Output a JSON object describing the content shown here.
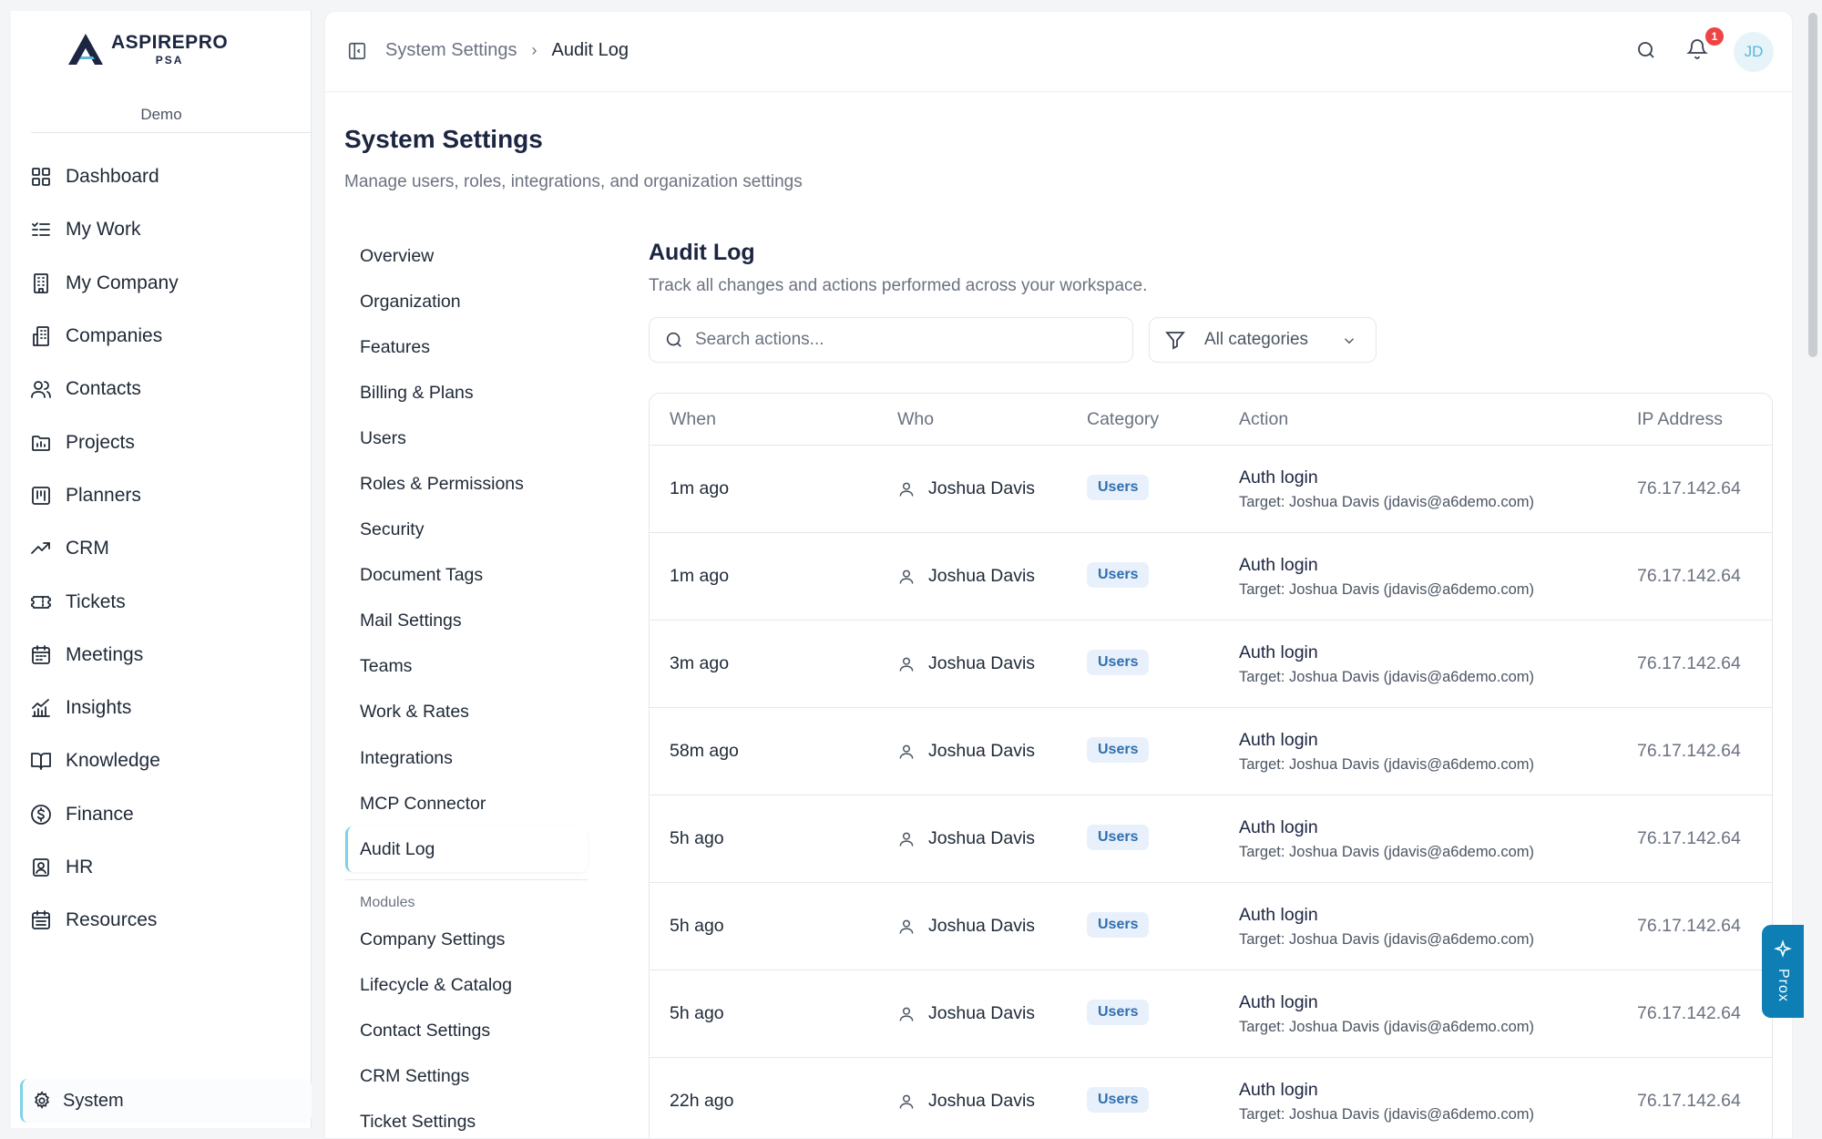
{
  "brand": {
    "name": "ASPIREPRO",
    "sub": "PSA",
    "workspace": "Demo"
  },
  "sidebar": {
    "items": [
      {
        "label": "Dashboard",
        "icon": "grid-icon"
      },
      {
        "label": "My Work",
        "icon": "list-check-icon"
      },
      {
        "label": "My Company",
        "icon": "building-icon"
      },
      {
        "label": "Companies",
        "icon": "buildings-icon"
      },
      {
        "label": "Contacts",
        "icon": "users-icon"
      },
      {
        "label": "Projects",
        "icon": "folder-chart-icon"
      },
      {
        "label": "Planners",
        "icon": "kanban-icon"
      },
      {
        "label": "CRM",
        "icon": "trending-up-icon"
      },
      {
        "label": "Tickets",
        "icon": "ticket-icon"
      },
      {
        "label": "Meetings",
        "icon": "calendar-icon"
      },
      {
        "label": "Insights",
        "icon": "bar-chart-icon"
      },
      {
        "label": "Knowledge",
        "icon": "book-open-icon"
      },
      {
        "label": "Finance",
        "icon": "dollar-circle-icon"
      },
      {
        "label": "HR",
        "icon": "id-badge-icon"
      },
      {
        "label": "Resources",
        "icon": "calendar-grid-icon"
      }
    ],
    "system_label": "System"
  },
  "topbar": {
    "breadcrumb_parent": "System Settings",
    "breadcrumb_current": "Audit Log",
    "notification_count": "1",
    "avatar_initials": "JD"
  },
  "page": {
    "title": "System Settings",
    "subtitle": "Manage users, roles, integrations, and organization settings"
  },
  "settings_nav": {
    "items": [
      "Overview",
      "Organization",
      "Features",
      "Billing & Plans",
      "Users",
      "Roles & Permissions",
      "Security",
      "Document Tags",
      "Mail Settings",
      "Teams",
      "Work & Rates",
      "Integrations",
      "MCP Connector",
      "Audit Log"
    ],
    "active": "Audit Log",
    "modules_label": "Modules",
    "modules": [
      "Company Settings",
      "Lifecycle & Catalog",
      "Contact Settings",
      "CRM Settings",
      "Ticket Settings"
    ]
  },
  "audit": {
    "title": "Audit Log",
    "subtitle": "Track all changes and actions performed across your workspace.",
    "search_placeholder": "Search actions...",
    "filter_label": "All categories",
    "columns": [
      "When",
      "Who",
      "Category",
      "Action",
      "IP Address"
    ],
    "rows": [
      {
        "when": "1m ago",
        "who": "Joshua Davis",
        "category": "Users",
        "action": "Auth login",
        "target_prefix": "Target:",
        "target": "Joshua Davis (jdavis@a6demo.com)",
        "ip": "76.17.142.64"
      },
      {
        "when": "1m ago",
        "who": "Joshua Davis",
        "category": "Users",
        "action": "Auth login",
        "target_prefix": "Target:",
        "target": "Joshua Davis (jdavis@a6demo.com)",
        "ip": "76.17.142.64"
      },
      {
        "when": "3m ago",
        "who": "Joshua Davis",
        "category": "Users",
        "action": "Auth login",
        "target_prefix": "Target:",
        "target": "Joshua Davis (jdavis@a6demo.com)",
        "ip": "76.17.142.64"
      },
      {
        "when": "58m ago",
        "who": "Joshua Davis",
        "category": "Users",
        "action": "Auth login",
        "target_prefix": "Target:",
        "target": "Joshua Davis (jdavis@a6demo.com)",
        "ip": "76.17.142.64"
      },
      {
        "when": "5h ago",
        "who": "Joshua Davis",
        "category": "Users",
        "action": "Auth login",
        "target_prefix": "Target:",
        "target": "Joshua Davis (jdavis@a6demo.com)",
        "ip": "76.17.142.64"
      },
      {
        "when": "5h ago",
        "who": "Joshua Davis",
        "category": "Users",
        "action": "Auth login",
        "target_prefix": "Target:",
        "target": "Joshua Davis (jdavis@a6demo.com)",
        "ip": "76.17.142.64"
      },
      {
        "when": "5h ago",
        "who": "Joshua Davis",
        "category": "Users",
        "action": "Auth login",
        "target_prefix": "Target:",
        "target": "Joshua Davis (jdavis@a6demo.com)",
        "ip": "76.17.142.64"
      },
      {
        "when": "22h ago",
        "who": "Joshua Davis",
        "category": "Users",
        "action": "Auth login",
        "target_prefix": "Target:",
        "target": "Joshua Davis (jdavis@a6demo.com)",
        "ip": "76.17.142.64"
      }
    ]
  },
  "assistant": {
    "label": "Prox",
    "icon": "sparkle-icon"
  },
  "colors": {
    "accent": "#7dd3e8",
    "brand_navy": "#1c2541",
    "badge_bg": "#e8f1fb",
    "badge_text": "#2f6fb0",
    "notification": "#ef4444",
    "assistant_bg": "#0d7fb5"
  }
}
